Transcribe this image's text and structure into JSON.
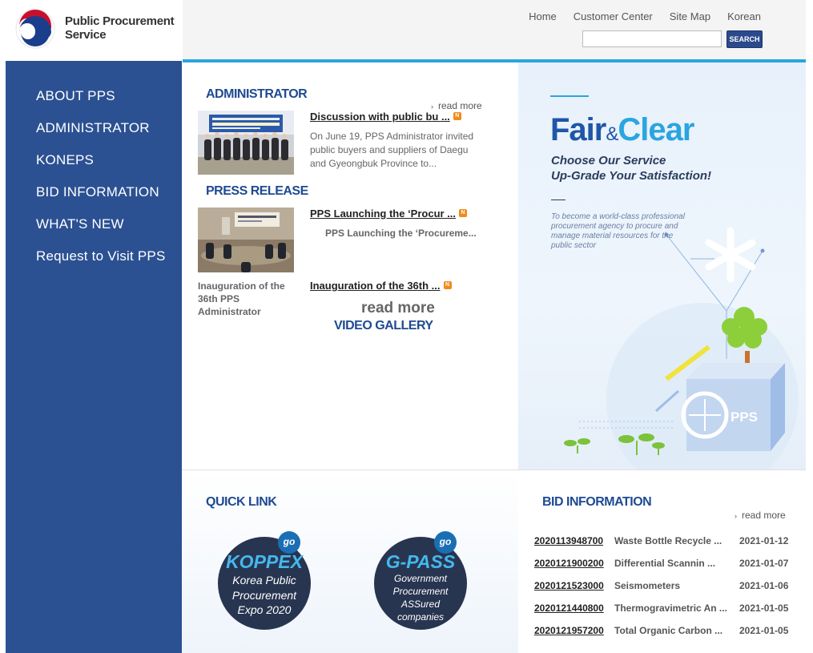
{
  "header": {
    "org_name_line1": "Public Procurement",
    "org_name_line2": "Service",
    "util_nav": [
      "Home",
      "Customer Center",
      "Site Map",
      "Korean"
    ],
    "search_placeholder": "",
    "search_button": "SEARCH"
  },
  "sidebar": {
    "items": [
      "ABOUT PPS",
      "ADMINISTRATOR",
      "KONEPS",
      "BID INFORMATION",
      "WHAT'S NEW",
      "Request to Visit PPS"
    ]
  },
  "main": {
    "administrator": {
      "title": "ADMINISTRATOR",
      "read_more": "read more",
      "news_title": "Discussion with public bu ...",
      "news_body": "On June 19, PPS Administrator invited public buyers and suppliers of Daegu and Gyeongbuk Province to..."
    },
    "press": {
      "title": "PRESS RELEASE",
      "news_title": "PPS Launching the ‘Procur ...",
      "news_body": "PPS Launching the ‘Procureme...",
      "caption": "Inauguration of the 36th PPS Administrator",
      "news_title2": "Inauguration of the 36th ...",
      "read_more": "read more"
    },
    "video": {
      "title": "VIDEO GALLERY"
    }
  },
  "banner": {
    "fair": "Fair",
    "amp": "&",
    "clear": "Clear",
    "line1": "Choose Our Service",
    "line2": "Up-Grade Your Satisfaction!",
    "desc": "To become a world-class professional procurement agency to procure and manage material resources for the public sector",
    "box_label": "PPS"
  },
  "quick_link": {
    "title": "QUICK LINK",
    "go": "go",
    "koppex": {
      "big": "KOPPEX",
      "sub1": "Korea Public",
      "sub2": "Procurement",
      "sub3": "Expo 2020"
    },
    "gpass": {
      "big": "G-PASS",
      "sub1": "Government",
      "sub2": "Procurement",
      "sub3": "ASSured",
      "sub4": "companies"
    }
  },
  "bid_info": {
    "title": "BID INFORMATION",
    "read_more": "read more",
    "rows": [
      {
        "num": "2020113948700",
        "name": "Waste Bottle Recycle ...",
        "date": "2021-01-12"
      },
      {
        "num": "2020121900200",
        "name": "Differential Scannin ...",
        "date": "2021-01-07"
      },
      {
        "num": "2020121523000",
        "name": "Seismometers",
        "date": "2021-01-06"
      },
      {
        "num": "2020121440800",
        "name": "Thermogravimetric An ...",
        "date": "2021-01-05"
      },
      {
        "num": "2020121957200",
        "name": "Total Organic Carbon ...",
        "date": "2021-01-05"
      }
    ]
  },
  "colors": {
    "sidebar": "#2b5193",
    "title_blue": "#1e4a93",
    "accent": "#2aa5e0"
  }
}
